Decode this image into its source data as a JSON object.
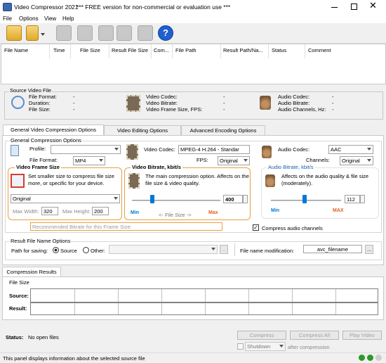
{
  "app": {
    "title": "Video Compressor 2021",
    "subtitle": "*** FREE version for non-commercial or evaluation use ***"
  },
  "menu": [
    "File",
    "Options",
    "View",
    "Help"
  ],
  "toolbar": {
    "icons": [
      "open-folder-icon",
      "open-folder-dropdown-icon",
      "add-file-icon",
      "add-batch-icon",
      "pause-icon",
      "stop-icon",
      "play-queue-icon",
      "help-icon"
    ]
  },
  "file_list": {
    "columns": [
      "File Name",
      "Time",
      "File Size",
      "Result File Size",
      "Com...",
      "File Path",
      "Result Path/Na...",
      "Status",
      "Comment"
    ]
  },
  "source": {
    "title": "Source Video File",
    "format_label": "File Format:",
    "format_value": "-",
    "duration_label": "Duration:",
    "duration_value": "-",
    "size_label": "File Size:",
    "size_value": "-",
    "vcodec_label": "Video Codec:",
    "vcodec_value": "-",
    "vbitrate_label": "Video Bitrate:",
    "vbitrate_value": "-",
    "vframe_label": "Video Frame Size, FPS:",
    "vframe_value": "-",
    "acodec_label": "Audio Codec:",
    "acodec_value": "-",
    "abitrate_label": "Audio Bitrate:",
    "abitrate_value": "-",
    "achannels_label": "Audio Channels, Hz:",
    "achannels_value": "-"
  },
  "tabs": [
    "General Video Compression Options",
    "Video Editing Options",
    "Advanced Encoding Options"
  ],
  "general": {
    "title": "General Compression Options",
    "profile_label": "Profile:",
    "profile_value": "",
    "format_label": "File Format:",
    "format_value": "MP4",
    "vcodec_label": "Video Codec:",
    "vcodec_value": "MPEG-4 H.264 - Standar",
    "fps_label": "FPS:",
    "fps_value": "Original",
    "acodec_label": "Audio Codec:",
    "acodec_value": "AAC",
    "channels_label": "Channels:",
    "channels_value": "Original"
  },
  "frame_size": {
    "title": "Video Frame Size",
    "desc": "Set smaller size to compress file size more, or specific for your device.",
    "preset": "Original",
    "max_width_label": "Max Width:",
    "max_width": "320",
    "max_height_label": "Max Height:",
    "max_height": "200",
    "recommended_placeholder": "Recommended Bitrate for this Frame Size:"
  },
  "video_bitrate": {
    "title": "Video Bitrate, kbit/s",
    "desc": "The main compression option. Affects on the file size & video quality.",
    "value": "400",
    "min": "Min",
    "max": "Max",
    "scale_label": "<- File Size ->",
    "level": 0.23
  },
  "audio_bitrate": {
    "title": "Audio Bitrate, kbit/s",
    "desc": "Affects on the audio quality & file size (moderately).",
    "value": "112",
    "min": "Min",
    "max": "MAX",
    "level": 0.48,
    "compress_label": "Compress audio channels",
    "compress_checked": true
  },
  "result_name": {
    "title": "Result File Name Options",
    "path_label": "Path for saving:",
    "source_label": "Source",
    "other_label": "Other:",
    "browse": "...",
    "mod_label": "File name modification:",
    "mod_value": "avc_filename",
    "mod_browse": "..."
  },
  "results": {
    "tab": "Compression Results",
    "file_size_label": "File Size",
    "source_label": "Source:",
    "result_label": "Result:"
  },
  "status": {
    "label": "Status:",
    "value": "No open files",
    "compress": "Compress",
    "compress_all": "Compress All",
    "play_video": "Play Video",
    "shutdown_value": "Shutdown",
    "after_label": "after compression"
  },
  "footer": "This panel displays information about the selected source file",
  "colors": {
    "accent_orange": "#e8a040",
    "blue": "#0078d7",
    "link_blue": "#1a5fb4"
  }
}
